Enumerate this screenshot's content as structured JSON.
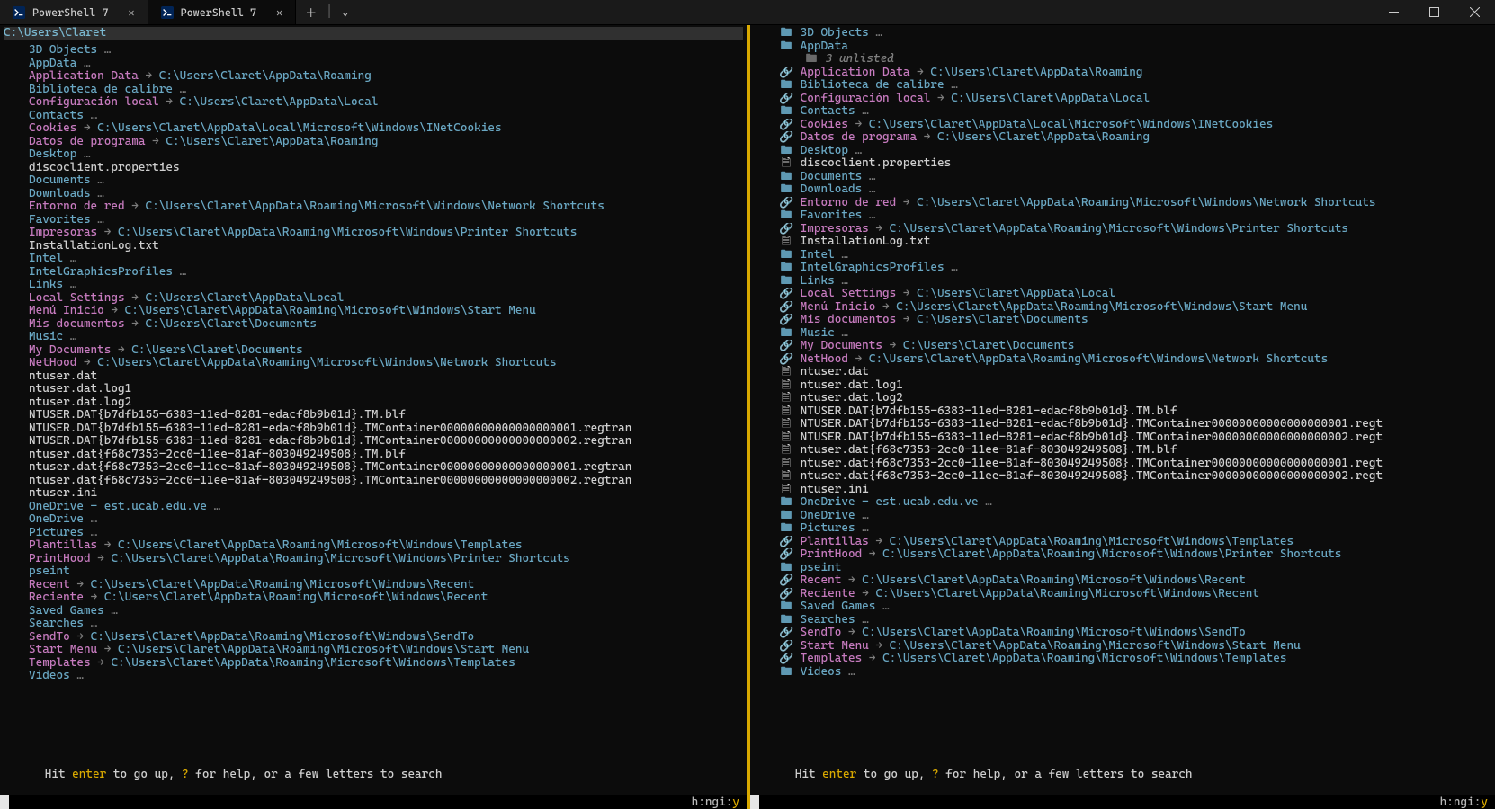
{
  "tabs": [
    {
      "label": "PowerShell 7",
      "active": false
    },
    {
      "label": "PowerShell 7",
      "active": true
    }
  ],
  "hint": {
    "prefix": "Hit ",
    "enter": "enter",
    "mid1": " to go up, ",
    "q": "?",
    "suffix": " for help, or a few letters to search"
  },
  "status": {
    "left": "h:n  ",
    "right_key": "gi:",
    "right_val": "y"
  },
  "left": {
    "cwd": "C:\\Users\\Claret",
    "show_icons": false,
    "entries": [
      {
        "t": "folder",
        "name": "3D Objects",
        "ell": true
      },
      {
        "t": "folder",
        "name": "AppData",
        "ell": true
      },
      {
        "t": "sym",
        "name": "Application Data",
        "target": "C:\\Users\\Claret\\AppData\\Roaming"
      },
      {
        "t": "folder",
        "name": "Biblioteca de calibre",
        "ell": true
      },
      {
        "t": "sym",
        "name": "Configuración local",
        "target": "C:\\Users\\Claret\\AppData\\Local"
      },
      {
        "t": "folder",
        "name": "Contacts",
        "ell": true
      },
      {
        "t": "sym",
        "name": "Cookies",
        "target": "C:\\Users\\Claret\\AppData\\Local\\Microsoft\\Windows\\INetCookies"
      },
      {
        "t": "sym",
        "name": "Datos de programa",
        "target": "C:\\Users\\Claret\\AppData\\Roaming"
      },
      {
        "t": "folder",
        "name": "Desktop",
        "ell": true
      },
      {
        "t": "file",
        "name": "discoclient.properties"
      },
      {
        "t": "folder",
        "name": "Documents",
        "ell": true
      },
      {
        "t": "folder",
        "name": "Downloads",
        "ell": true
      },
      {
        "t": "sym",
        "name": "Entorno de red",
        "target": "C:\\Users\\Claret\\AppData\\Roaming\\Microsoft\\Windows\\Network Shortcuts"
      },
      {
        "t": "folder",
        "name": "Favorites",
        "ell": true
      },
      {
        "t": "sym",
        "name": "Impresoras",
        "target": "C:\\Users\\Claret\\AppData\\Roaming\\Microsoft\\Windows\\Printer Shortcuts"
      },
      {
        "t": "file",
        "name": "InstallationLog.txt"
      },
      {
        "t": "folder",
        "name": "Intel",
        "ell": true
      },
      {
        "t": "folder",
        "name": "IntelGraphicsProfiles",
        "ell": true
      },
      {
        "t": "folder",
        "name": "Links",
        "ell": true
      },
      {
        "t": "sym",
        "name": "Local Settings",
        "target": "C:\\Users\\Claret\\AppData\\Local"
      },
      {
        "t": "sym",
        "name": "Menú Inicio",
        "target": "C:\\Users\\Claret\\AppData\\Roaming\\Microsoft\\Windows\\Start Menu"
      },
      {
        "t": "sym",
        "name": "Mis documentos",
        "target": "C:\\Users\\Claret\\Documents"
      },
      {
        "t": "folder",
        "name": "Music",
        "ell": true
      },
      {
        "t": "sym",
        "name": "My Documents",
        "target": "C:\\Users\\Claret\\Documents"
      },
      {
        "t": "sym",
        "name": "NetHood",
        "target": "C:\\Users\\Claret\\AppData\\Roaming\\Microsoft\\Windows\\Network Shortcuts"
      },
      {
        "t": "file",
        "name": "ntuser.dat"
      },
      {
        "t": "file",
        "name": "ntuser.dat.log1"
      },
      {
        "t": "file",
        "name": "ntuser.dat.log2"
      },
      {
        "t": "file",
        "name": "NTUSER.DAT{b7dfb155-6383-11ed-8281-edacf8b9b01d}.TM.blf"
      },
      {
        "t": "file",
        "name": "NTUSER.DAT{b7dfb155-6383-11ed-8281-edacf8b9b01d}.TMContainer00000000000000000001.regtran"
      },
      {
        "t": "file",
        "name": "NTUSER.DAT{b7dfb155-6383-11ed-8281-edacf8b9b01d}.TMContainer00000000000000000002.regtran"
      },
      {
        "t": "file",
        "name": "ntuser.dat{f68c7353-2cc0-11ee-81af-803049249508}.TM.blf"
      },
      {
        "t": "file",
        "name": "ntuser.dat{f68c7353-2cc0-11ee-81af-803049249508}.TMContainer00000000000000000001.regtran"
      },
      {
        "t": "file",
        "name": "ntuser.dat{f68c7353-2cc0-11ee-81af-803049249508}.TMContainer00000000000000000002.regtran"
      },
      {
        "t": "file",
        "name": "ntuser.ini"
      },
      {
        "t": "folder",
        "name": "OneDrive - est.ucab.edu.ve",
        "ell": true
      },
      {
        "t": "folder",
        "name": "OneDrive",
        "ell": true
      },
      {
        "t": "folder",
        "name": "Pictures",
        "ell": true
      },
      {
        "t": "sym",
        "name": "Plantillas",
        "target": "C:\\Users\\Claret\\AppData\\Roaming\\Microsoft\\Windows\\Templates"
      },
      {
        "t": "sym",
        "name": "PrintHood",
        "target": "C:\\Users\\Claret\\AppData\\Roaming\\Microsoft\\Windows\\Printer Shortcuts"
      },
      {
        "t": "folder",
        "name": "pseint"
      },
      {
        "t": "sym",
        "name": "Recent",
        "target": "C:\\Users\\Claret\\AppData\\Roaming\\Microsoft\\Windows\\Recent"
      },
      {
        "t": "sym",
        "name": "Reciente",
        "target": "C:\\Users\\Claret\\AppData\\Roaming\\Microsoft\\Windows\\Recent"
      },
      {
        "t": "folder",
        "name": "Saved Games",
        "ell": true
      },
      {
        "t": "folder",
        "name": "Searches",
        "ell": true
      },
      {
        "t": "sym",
        "name": "SendTo",
        "target": "C:\\Users\\Claret\\AppData\\Roaming\\Microsoft\\Windows\\SendTo"
      },
      {
        "t": "sym",
        "name": "Start Menu",
        "target": "C:\\Users\\Claret\\AppData\\Roaming\\Microsoft\\Windows\\Start Menu"
      },
      {
        "t": "sym",
        "name": "Templates",
        "target": "C:\\Users\\Claret\\AppData\\Roaming\\Microsoft\\Windows\\Templates"
      },
      {
        "t": "folder",
        "name": "Videos",
        "ell": true
      }
    ]
  },
  "right": {
    "show_icons": true,
    "unlisted": "3 unlisted",
    "entries": [
      {
        "t": "folder",
        "name": "3D Objects",
        "ell": true
      },
      {
        "t": "folder",
        "name": "AppData"
      },
      {
        "t": "unlisted"
      },
      {
        "t": "sym",
        "name": "Application Data",
        "target": "C:\\Users\\Claret\\AppData\\Roaming"
      },
      {
        "t": "folder",
        "name": "Biblioteca de calibre",
        "ell": true
      },
      {
        "t": "sym",
        "name": "Configuración local",
        "target": "C:\\Users\\Claret\\AppData\\Local"
      },
      {
        "t": "folder",
        "name": "Contacts",
        "ell": true
      },
      {
        "t": "sym",
        "name": "Cookies",
        "target": "C:\\Users\\Claret\\AppData\\Local\\Microsoft\\Windows\\INetCookies"
      },
      {
        "t": "sym",
        "name": "Datos de programa",
        "target": "C:\\Users\\Claret\\AppData\\Roaming"
      },
      {
        "t": "folder",
        "name": "Desktop",
        "ell": true
      },
      {
        "t": "file",
        "name": "discoclient.properties"
      },
      {
        "t": "folder",
        "name": "Documents",
        "ell": true
      },
      {
        "t": "folder",
        "name": "Downloads",
        "ell": true
      },
      {
        "t": "sym",
        "name": "Entorno de red",
        "target": "C:\\Users\\Claret\\AppData\\Roaming\\Microsoft\\Windows\\Network Shortcuts"
      },
      {
        "t": "folder",
        "name": "Favorites",
        "ell": true
      },
      {
        "t": "sym",
        "name": "Impresoras",
        "target": "C:\\Users\\Claret\\AppData\\Roaming\\Microsoft\\Windows\\Printer Shortcuts"
      },
      {
        "t": "file",
        "name": "InstallationLog.txt"
      },
      {
        "t": "folder",
        "name": "Intel",
        "ell": true
      },
      {
        "t": "folder",
        "name": "IntelGraphicsProfiles",
        "ell": true
      },
      {
        "t": "folder",
        "name": "Links",
        "ell": true
      },
      {
        "t": "sym",
        "name": "Local Settings",
        "target": "C:\\Users\\Claret\\AppData\\Local"
      },
      {
        "t": "sym",
        "name": "Menú Inicio",
        "target": "C:\\Users\\Claret\\AppData\\Roaming\\Microsoft\\Windows\\Start Menu"
      },
      {
        "t": "sym",
        "name": "Mis documentos",
        "target": "C:\\Users\\Claret\\Documents"
      },
      {
        "t": "folder",
        "name": "Music",
        "ell": true
      },
      {
        "t": "sym",
        "name": "My Documents",
        "target": "C:\\Users\\Claret\\Documents"
      },
      {
        "t": "sym",
        "name": "NetHood",
        "target": "C:\\Users\\Claret\\AppData\\Roaming\\Microsoft\\Windows\\Network Shortcuts"
      },
      {
        "t": "file",
        "name": "ntuser.dat"
      },
      {
        "t": "file",
        "name": "ntuser.dat.log1"
      },
      {
        "t": "file",
        "name": "ntuser.dat.log2"
      },
      {
        "t": "file",
        "name": "NTUSER.DAT{b7dfb155-6383-11ed-8281-edacf8b9b01d}.TM.blf"
      },
      {
        "t": "file",
        "name": "NTUSER.DAT{b7dfb155-6383-11ed-8281-edacf8b9b01d}.TMContainer00000000000000000001.regt"
      },
      {
        "t": "file",
        "name": "NTUSER.DAT{b7dfb155-6383-11ed-8281-edacf8b9b01d}.TMContainer00000000000000000002.regt"
      },
      {
        "t": "file",
        "name": "ntuser.dat{f68c7353-2cc0-11ee-81af-803049249508}.TM.blf"
      },
      {
        "t": "file",
        "name": "ntuser.dat{f68c7353-2cc0-11ee-81af-803049249508}.TMContainer00000000000000000001.regt"
      },
      {
        "t": "file",
        "name": "ntuser.dat{f68c7353-2cc0-11ee-81af-803049249508}.TMContainer00000000000000000002.regt"
      },
      {
        "t": "file",
        "name": "ntuser.ini"
      },
      {
        "t": "folder",
        "name": "OneDrive - est.ucab.edu.ve",
        "ell": true
      },
      {
        "t": "folder",
        "name": "OneDrive",
        "ell": true
      },
      {
        "t": "folder",
        "name": "Pictures",
        "ell": true
      },
      {
        "t": "sym",
        "name": "Plantillas",
        "target": "C:\\Users\\Claret\\AppData\\Roaming\\Microsoft\\Windows\\Templates"
      },
      {
        "t": "sym",
        "name": "PrintHood",
        "target": "C:\\Users\\Claret\\AppData\\Roaming\\Microsoft\\Windows\\Printer Shortcuts"
      },
      {
        "t": "folder",
        "name": "pseint"
      },
      {
        "t": "sym",
        "name": "Recent",
        "target": "C:\\Users\\Claret\\AppData\\Roaming\\Microsoft\\Windows\\Recent"
      },
      {
        "t": "sym",
        "name": "Reciente",
        "target": "C:\\Users\\Claret\\AppData\\Roaming\\Microsoft\\Windows\\Recent"
      },
      {
        "t": "folder",
        "name": "Saved Games",
        "ell": true
      },
      {
        "t": "folder",
        "name": "Searches",
        "ell": true
      },
      {
        "t": "sym",
        "name": "SendTo",
        "target": "C:\\Users\\Claret\\AppData\\Roaming\\Microsoft\\Windows\\SendTo"
      },
      {
        "t": "sym",
        "name": "Start Menu",
        "target": "C:\\Users\\Claret\\AppData\\Roaming\\Microsoft\\Windows\\Start Menu"
      },
      {
        "t": "sym",
        "name": "Templates",
        "target": "C:\\Users\\Claret\\AppData\\Roaming\\Microsoft\\Windows\\Templates"
      },
      {
        "t": "folder",
        "name": "Videos",
        "ell": true
      }
    ]
  }
}
